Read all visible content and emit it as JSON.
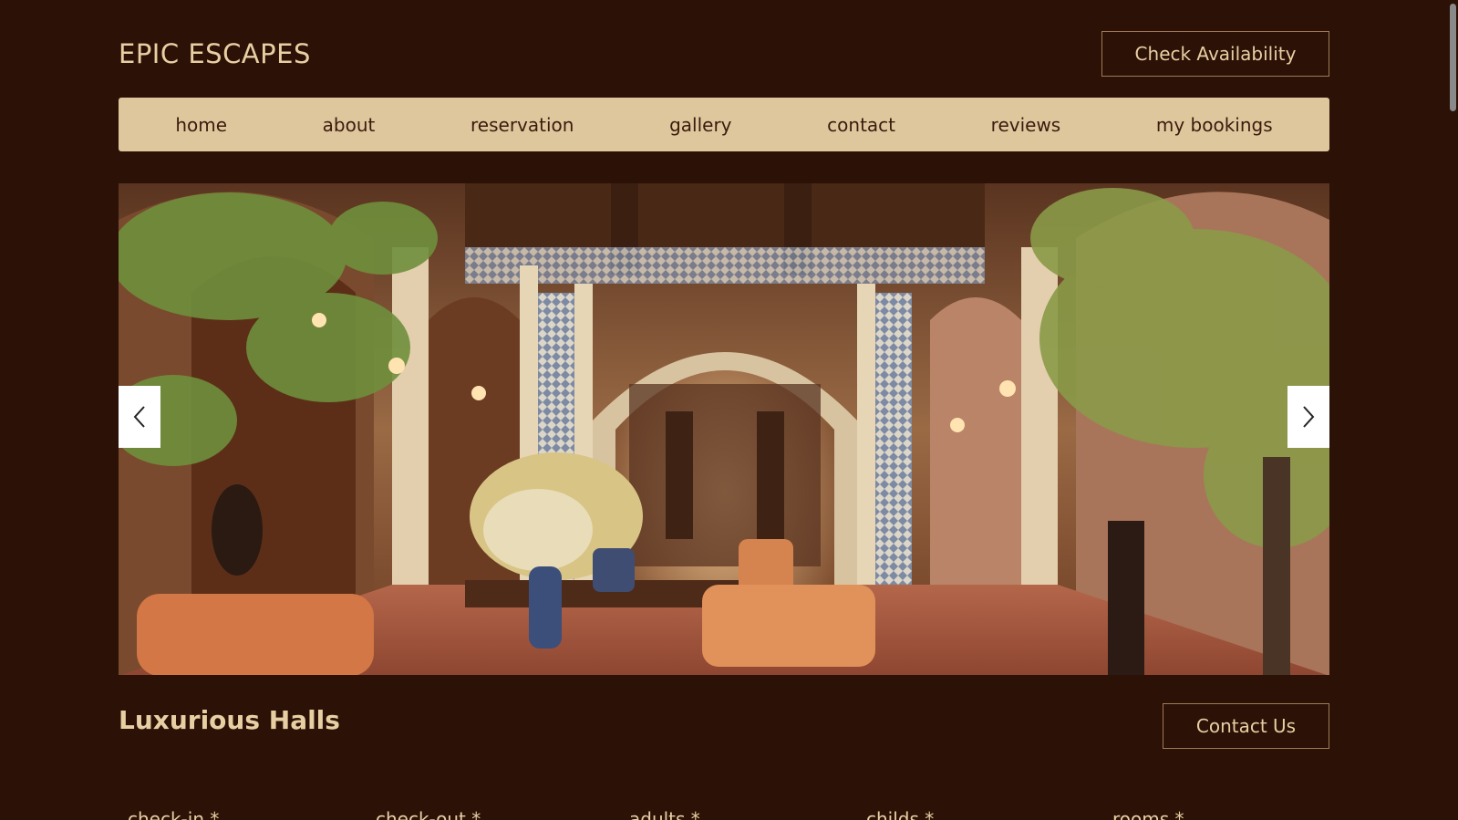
{
  "brand": {
    "name": "EPIC ESCAPES"
  },
  "header": {
    "check_availability_label": "Check Availability"
  },
  "nav": {
    "items": [
      {
        "label": "home"
      },
      {
        "label": "about"
      },
      {
        "label": "reservation"
      },
      {
        "label": "gallery"
      },
      {
        "label": "contact"
      },
      {
        "label": "reviews"
      },
      {
        "label": "my bookings"
      }
    ]
  },
  "slider": {
    "prev_icon": "chevron-left-icon",
    "next_icon": "chevron-right-icon"
  },
  "section": {
    "title": "Luxurious Halls",
    "contact_label": "Contact Us"
  },
  "form": {
    "labels": {
      "checkin": "check-in *",
      "checkout": "check-out *",
      "adults": "adults *",
      "childs": "childs *",
      "rooms": "rooms *"
    }
  },
  "colors": {
    "background": "#2b1106",
    "nav_background": "#dfc79d",
    "text_accent": "#e8cfa3",
    "nav_text": "#3a1c0e"
  }
}
